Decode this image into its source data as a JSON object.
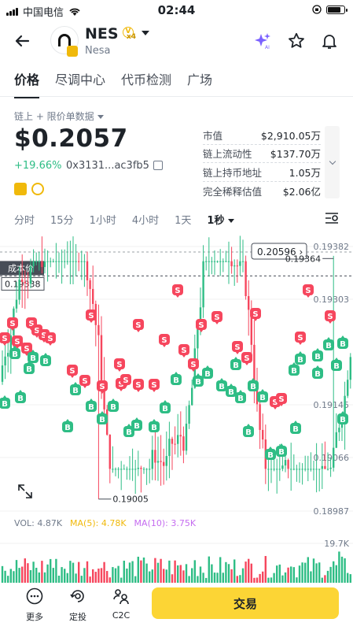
{
  "status": {
    "carrier": "中国电信",
    "time": "02:44"
  },
  "header": {
    "symbol": "NES",
    "name": "Nesa",
    "badge_text": "V",
    "multiplier": "x4"
  },
  "tabs": [
    "价格",
    "尽调中心",
    "代币检测",
    "广场"
  ],
  "price_panel": {
    "data_source": "链上 + 限价单数据",
    "price": "$0.2057",
    "change": "+19.66%",
    "contract": "0x3131...ac3fb5"
  },
  "stats": [
    {
      "label": "市值",
      "value": "$2,910.05万"
    },
    {
      "label": "链上流动性",
      "value": "$137.70万"
    },
    {
      "label": "链上持币地址",
      "value": "1.05万"
    },
    {
      "label": "完全稀释估值",
      "value": "$2.06亿"
    }
  ],
  "intervals": [
    "分时",
    "15分",
    "1小时",
    "4小时",
    "1天",
    "1秒"
  ],
  "active_interval": "1秒",
  "chart_labels": {
    "cost_tag": "成本价",
    "cost_value": "0.19338",
    "current_tag": "0.20596",
    "high_label": "0.19364",
    "low_label": "0.19005",
    "y_ticks": [
      "0.19382",
      "0.19303",
      "0.19145",
      "0.19066",
      "0.18987"
    ],
    "vol_max": "19.7K",
    "marker_sell": "S",
    "marker_buy": "B"
  },
  "volume_legend": {
    "vol": "VOL: 4.87K",
    "ma5": "MA(5): 4.78K",
    "ma10": "MA(10): 3.75K"
  },
  "chart_data": {
    "type": "candlestick",
    "y_ticks": [
      0.19382,
      0.19303,
      0.19145,
      0.19066,
      0.18987
    ],
    "current_price": 0.20596,
    "cost_price": 0.19338,
    "high": 0.19364,
    "low": 0.19005,
    "volume_max": "19.7K",
    "volume": "4.87K",
    "ma5": "4.78K",
    "ma10": "3.75K"
  },
  "bottom_bar": {
    "more": "更多",
    "dca": "定投",
    "c2c": "C2C",
    "trade": "交易"
  },
  "colors": {
    "up": "#2ebd85",
    "down": "#f6465d",
    "accent": "#fcd535"
  }
}
